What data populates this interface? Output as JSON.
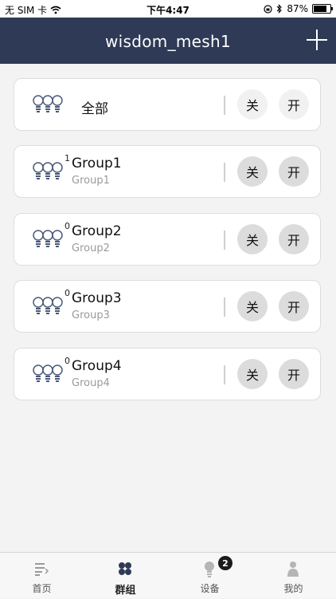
{
  "status_bar": {
    "carrier": "无 SIM 卡",
    "time": "下午4:47",
    "battery_percent": "87%",
    "battery_level": 0.87,
    "icons": [
      "wifi-icon",
      "orientation-lock-icon",
      "bluetooth-icon",
      "battery-icon"
    ]
  },
  "header": {
    "title": "wisdom_mesh1",
    "add_icon": "plus-icon"
  },
  "all_row": {
    "label": "全部",
    "off_label": "关",
    "on_label": "开"
  },
  "groups": [
    {
      "count": "1",
      "name": "Group1",
      "subtitle": "Group1",
      "off_label": "关",
      "on_label": "开"
    },
    {
      "count": "0",
      "name": "Group2",
      "subtitle": "Group2",
      "off_label": "关",
      "on_label": "开"
    },
    {
      "count": "0",
      "name": "Group3",
      "subtitle": "Group3",
      "off_label": "关",
      "on_label": "开"
    },
    {
      "count": "0",
      "name": "Group4",
      "subtitle": "Group4",
      "off_label": "关",
      "on_label": "开"
    }
  ],
  "tabs": [
    {
      "label": "首页",
      "icon": "home-list-icon",
      "active": false
    },
    {
      "label": "群组",
      "icon": "groups-icon",
      "active": true
    },
    {
      "label": "设备",
      "icon": "bulb-icon",
      "active": false,
      "badge": "2"
    },
    {
      "label": "我的",
      "icon": "user-icon",
      "active": false
    }
  ],
  "colors": {
    "header_bg": "#2e3a56",
    "page_bg": "#f4f3f3",
    "card_bg": "#ffffff",
    "button_bg": "#dcdcdc"
  }
}
